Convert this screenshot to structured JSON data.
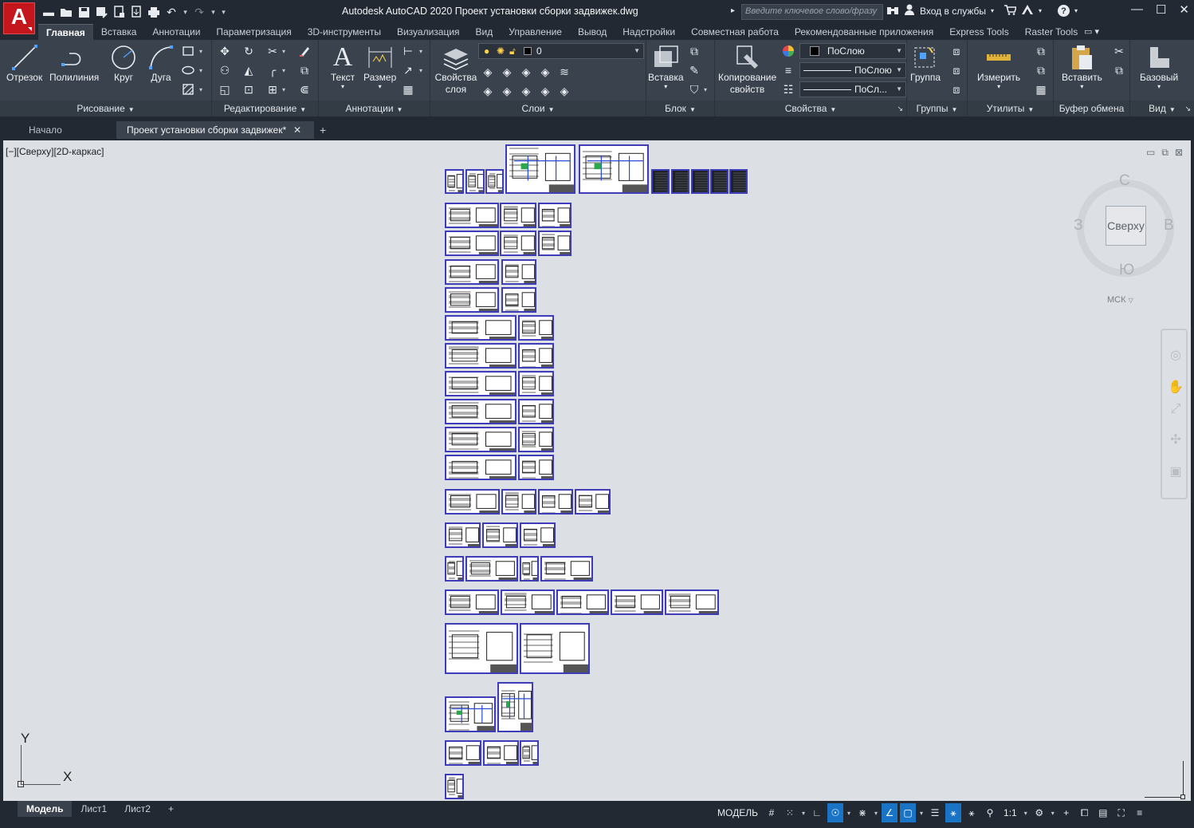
{
  "app": {
    "logo_letter": "A",
    "title": "Autodesk AutoCAD 2020   Проект установки сборки задвижек.dwg",
    "search_placeholder": "Введите ключевое слово/фразу",
    "signin_label": "Вход в службы"
  },
  "ribbon_tabs": [
    "Главная",
    "Вставка",
    "Аннотации",
    "Параметризация",
    "3D-инструменты",
    "Визуализация",
    "Вид",
    "Управление",
    "Вывод",
    "Надстройки",
    "Совместная работа",
    "Рекомендованные приложения",
    "Express Tools",
    "Raster Tools"
  ],
  "panels": {
    "draw": {
      "title": "Рисование",
      "line": "Отрезок",
      "polyline": "Полилиния",
      "circle": "Круг",
      "arc": "Дуга"
    },
    "modify": {
      "title": "Редактирование"
    },
    "annotation": {
      "title": "Аннотации",
      "text": "Текст",
      "dimension": "Размер"
    },
    "layers": {
      "title": "Слои",
      "layer_props_1": "Свойства",
      "layer_props_2": "слоя",
      "current_layer": "0"
    },
    "block": {
      "title": "Блок",
      "insert": "Вставка"
    },
    "properties": {
      "title": "Свойства",
      "match_1": "Копирование",
      "match_2": "свойств",
      "color": "ПоСлою",
      "linetype": "ПоСлою",
      "lineweight": "ПоСл..."
    },
    "groups": {
      "title": "Группы",
      "group": "Группа"
    },
    "utilities": {
      "title": "Утилиты",
      "measure": "Измерить"
    },
    "clipboard": {
      "title": "Буфер обмена",
      "paste": "Вставить"
    },
    "view": {
      "title": "Вид",
      "base": "Базовый"
    }
  },
  "file_tabs": {
    "start": "Начало",
    "active": "Проект установки сборки задвижек*"
  },
  "viewport": {
    "label": "[−][Сверху][2D-каркас]",
    "viewcube": {
      "face": "Сверху",
      "north": "С",
      "south": "Ю",
      "west": "З",
      "east": "В",
      "ucs": "МСК"
    },
    "ucs_x": "X",
    "ucs_y": "Y"
  },
  "layout_tabs": [
    "Модель",
    "Лист1",
    "Лист2"
  ],
  "status": {
    "model": "МОДЕЛЬ",
    "scale": "1:1"
  },
  "colors": {
    "accent": "#1a74c6",
    "logo": "#c4161d",
    "sheet_frame": "#3e3cb8",
    "canvas": "#dcdfe3"
  }
}
